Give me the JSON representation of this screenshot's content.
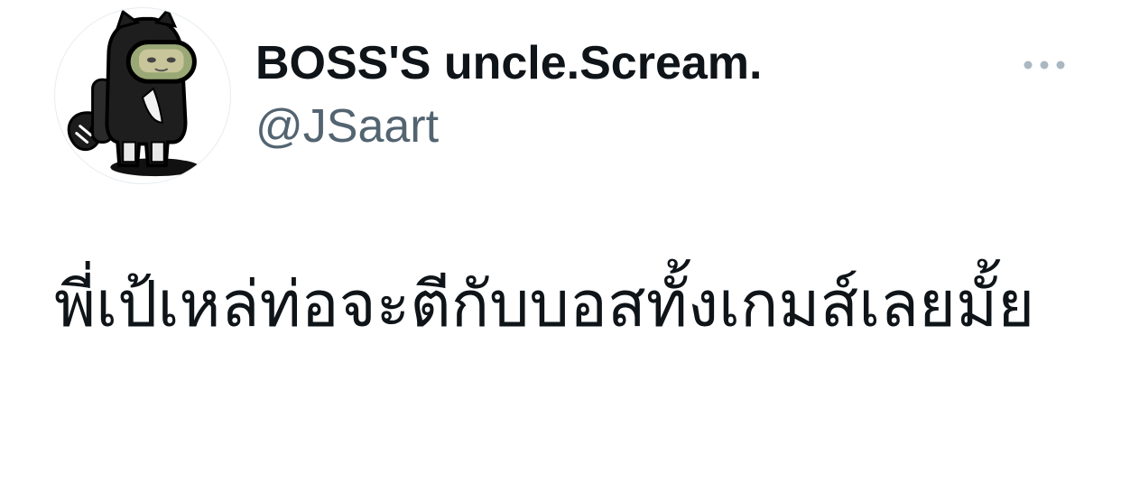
{
  "tweet": {
    "author": {
      "display_name": "BOSS'S uncle.Scream.",
      "handle": "@JSaart",
      "avatar_icon": "black-dog-crewmate-avatar"
    },
    "more_icon": "more-dots-icon",
    "text": "พี่เป้เหล่ท่อจะตีกับบอสทั้งเกมส์เลยมั้ย"
  },
  "colors": {
    "text_primary": "#0f1419",
    "text_secondary": "#536471",
    "icon_muted": "#aab8c2",
    "background": "#ffffff"
  }
}
